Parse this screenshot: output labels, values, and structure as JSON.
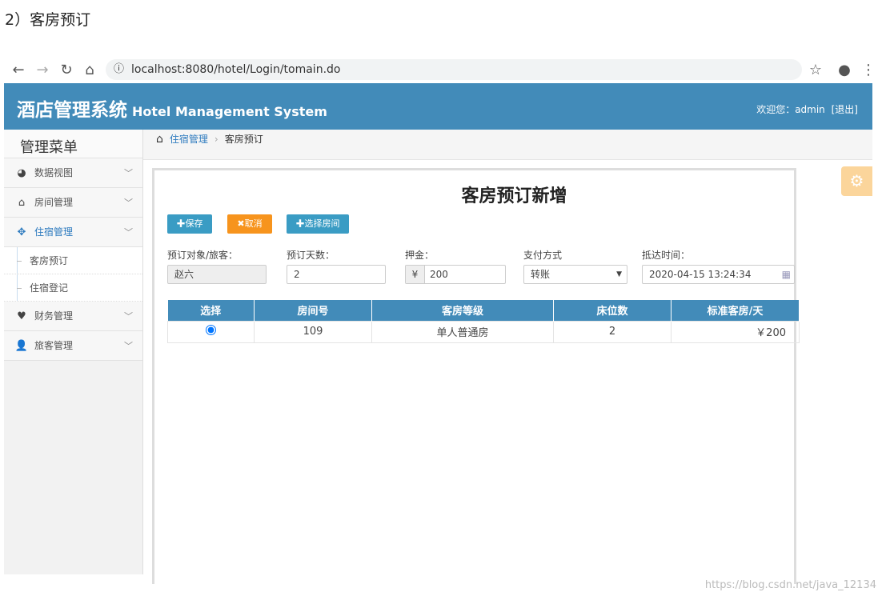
{
  "caption": "2）客房预订",
  "browser": {
    "url": "localhost:8080/hotel/Login/tomain.do",
    "back_icon": "arrow-left",
    "forward_icon": "arrow-right",
    "reload_icon": "reload",
    "home_icon": "home"
  },
  "header": {
    "title_cn": "酒店管理系统",
    "title_en": "Hotel Management System",
    "welcome": "欢迎您：admin",
    "logout": "[退出]",
    "color": "#428bb9"
  },
  "sidebar": {
    "title": "管理菜单",
    "items": [
      {
        "label": "数据视图",
        "icon": "dashboard"
      },
      {
        "label": "房间管理",
        "icon": "home"
      },
      {
        "label": "住宿管理",
        "icon": "arrows",
        "active": true,
        "children": [
          "客房预订",
          "住宿登记"
        ]
      },
      {
        "label": "财务管理",
        "icon": "heart"
      },
      {
        "label": "旅客管理",
        "icon": "user"
      }
    ]
  },
  "breadcrumb": {
    "parent": "住宿管理",
    "current": "客房预订"
  },
  "panel": {
    "title": "客房预订新增",
    "buttons": {
      "save": "✚保存",
      "cancel": "✖取消",
      "select_room": "✚选择房间"
    },
    "form": {
      "guest_label": "预订对象/旅客：",
      "guest_value": "赵六",
      "days_label": "预订天数：",
      "days_value": "2",
      "deposit_label": "押金：",
      "deposit_prefix": "¥",
      "deposit_value": "200",
      "pay_label": "支付方式",
      "pay_value": "转账",
      "arrive_label": "抵达时间：",
      "arrive_value": "2020-04-15 13:24:34"
    },
    "table": {
      "headers": [
        "选择",
        "房间号",
        "客房等级",
        "床位数",
        "标准客房/天"
      ],
      "rows": [
        {
          "selected": true,
          "room": "109",
          "grade": "单人普通房",
          "beds": "2",
          "price": "￥200"
        }
      ]
    }
  },
  "watermark": "https://blog.csdn.net/java_12134"
}
